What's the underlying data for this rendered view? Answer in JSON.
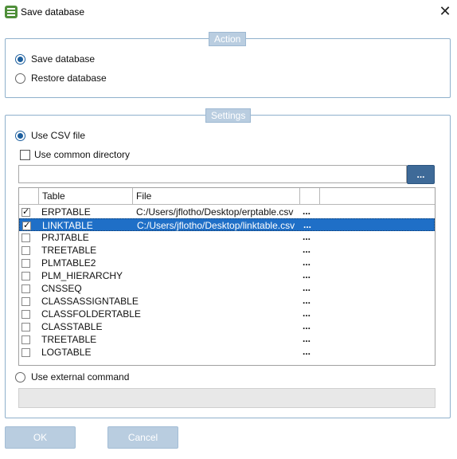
{
  "window": {
    "title": "Save database",
    "close_glyph": "✕"
  },
  "action": {
    "legend": "Action",
    "options": [
      {
        "label": "Save database",
        "selected": true
      },
      {
        "label": "Restore database",
        "selected": false
      }
    ]
  },
  "settings": {
    "legend": "Settings",
    "use_csv_label": "Use CSV file",
    "use_common_dir_label": "Use common directory",
    "directory_value": "",
    "browse_label": "...",
    "table": {
      "columns": [
        "Table",
        "File"
      ],
      "rows": [
        {
          "checked": true,
          "table": "ERPTABLE",
          "file": "C:/Users/jflotho/Desktop/erptable.csv",
          "more": "...",
          "selected": false
        },
        {
          "checked": true,
          "table": "LINKTABLE",
          "file": "C:/Users/jflotho/Desktop/linktable.csv",
          "more": "...",
          "selected": true
        },
        {
          "checked": false,
          "table": "PRJTABLE",
          "file": "",
          "more": "...",
          "selected": false
        },
        {
          "checked": false,
          "table": "TREETABLE",
          "file": "",
          "more": "...",
          "selected": false
        },
        {
          "checked": false,
          "table": "PLMTABLE2",
          "file": "",
          "more": "...",
          "selected": false
        },
        {
          "checked": false,
          "table": "PLM_HIERARCHY",
          "file": "",
          "more": "...",
          "selected": false
        },
        {
          "checked": false,
          "table": "CNSSEQ",
          "file": "",
          "more": "...",
          "selected": false
        },
        {
          "checked": false,
          "table": "CLASSASSIGNTABLE",
          "file": "",
          "more": "...",
          "selected": false
        },
        {
          "checked": false,
          "table": "CLASSFOLDERTABLE",
          "file": "",
          "more": "...",
          "selected": false
        },
        {
          "checked": false,
          "table": "CLASSTABLE",
          "file": "",
          "more": "...",
          "selected": false
        },
        {
          "checked": false,
          "table": "TREETABLE",
          "file": "",
          "more": "...",
          "selected": false
        },
        {
          "checked": false,
          "table": "LOGTABLE",
          "file": "",
          "more": "...",
          "selected": false
        }
      ]
    },
    "use_external_label": "Use external command",
    "external_command_value": ""
  },
  "buttons": {
    "ok": "OK",
    "cancel": "Cancel"
  },
  "colors": {
    "accent": "#1d5f9e",
    "selection": "#1f6fc7",
    "legend_bg": "#b9cde0",
    "disabled_button": "#b9cde0"
  }
}
